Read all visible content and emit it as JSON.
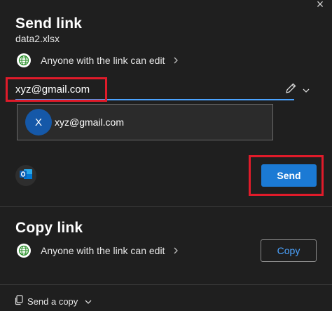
{
  "dialog": {
    "close_glyph": "×"
  },
  "send_link": {
    "title": "Send link",
    "file_name": "data2.xlsx",
    "permission_text": "Anyone with the link can edit",
    "email_value": "xyz@gmail.com",
    "suggestion": {
      "avatar_initial": "X",
      "email": "xyz@gmail.com"
    },
    "send_label": "Send"
  },
  "copy_link": {
    "title": "Copy link",
    "permission_text": "Anyone with the link can edit",
    "copy_label": "Copy"
  },
  "footer": {
    "send_copy_label": "Send a copy"
  },
  "colors": {
    "background": "#1f1f1f",
    "accent_blue": "#1b7ad4",
    "link_blue": "#4ba3ff",
    "highlight_red": "#e01b2a",
    "avatar_blue": "#1558a8"
  },
  "icons": {
    "permission": "globe-icon",
    "edit": "pencil-icon",
    "dropdown": "chevron-down-icon",
    "mail_app": "outlook-icon",
    "send_copy": "copy-icon"
  }
}
